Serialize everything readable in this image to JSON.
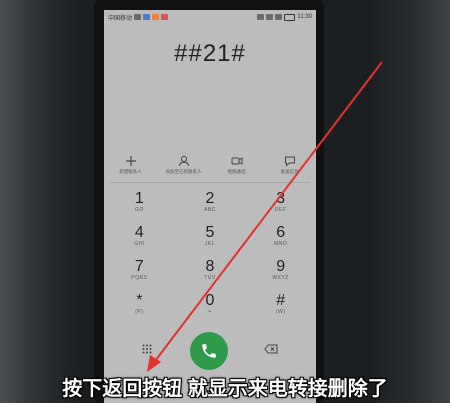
{
  "status_bar": {
    "carrier": "中国移动",
    "time": "11:30",
    "battery": "",
    "icons": [
      "notification-icon",
      "app-icon",
      "alarm-icon",
      "vibrate-icon",
      "wifi-icon",
      "signal-icon",
      "battery-icon"
    ]
  },
  "dialer": {
    "number": "##21#",
    "actions": [
      {
        "label": "新建联系人",
        "icon": "plus-icon"
      },
      {
        "label": "添加至已有联系人",
        "icon": "person-icon"
      },
      {
        "label": "视频通话",
        "icon": "video-icon"
      },
      {
        "label": "发送信息",
        "icon": "message-icon"
      }
    ],
    "keys": [
      {
        "digit": "1",
        "letters": "GO"
      },
      {
        "digit": "2",
        "letters": "ABC"
      },
      {
        "digit": "3",
        "letters": "DEF"
      },
      {
        "digit": "4",
        "letters": "GHI"
      },
      {
        "digit": "5",
        "letters": "JKL"
      },
      {
        "digit": "6",
        "letters": "MNO"
      },
      {
        "digit": "7",
        "letters": "PQRS"
      },
      {
        "digit": "8",
        "letters": "TUV"
      },
      {
        "digit": "9",
        "letters": "WXYZ"
      },
      {
        "digit": "*",
        "letters": "(P)"
      },
      {
        "digit": "0",
        "letters": "+"
      },
      {
        "digit": "#",
        "letters": "(W)"
      }
    ],
    "call_color": "#2f9a4a"
  },
  "caption": "按下返回按钮 就显示来电转接删除了",
  "annotation_color": "#e53030"
}
